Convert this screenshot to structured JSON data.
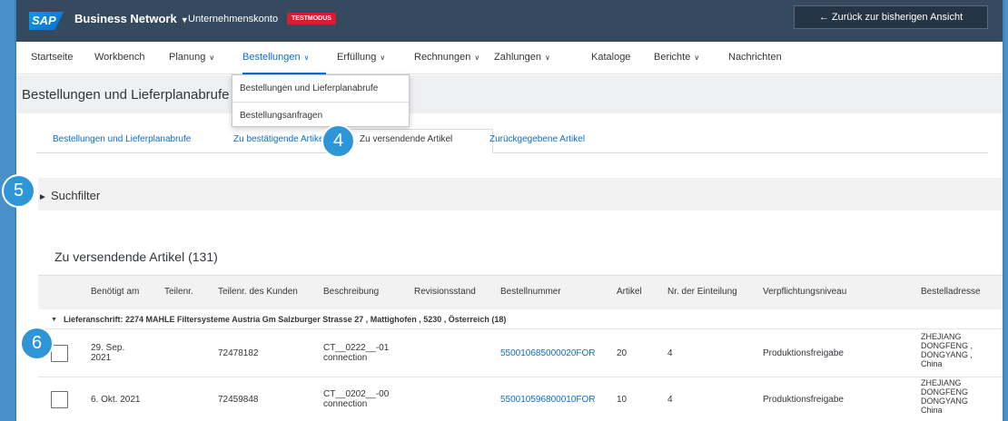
{
  "topbar": {
    "logo": "SAP",
    "product": "Business Network",
    "account": "Unternehmenskonto",
    "test_badge": "TESTMODUS",
    "back_button": "← Zurück zur bisherigen Ansicht"
  },
  "nav": {
    "items": [
      {
        "label": "Startseite"
      },
      {
        "label": "Workbench"
      },
      {
        "label": "Planung"
      },
      {
        "label": "Bestellungen"
      },
      {
        "label": "Erfüllung"
      },
      {
        "label": "Rechnungen"
      },
      {
        "label": "Zahlungen"
      },
      {
        "label": "Kataloge"
      },
      {
        "label": "Berichte"
      },
      {
        "label": "Nachrichten"
      }
    ],
    "chevron": "∨"
  },
  "dropdown": {
    "items": [
      {
        "label": "Bestellungen und Lieferplanabrufe"
      },
      {
        "label": "Bestellungsanfragen"
      }
    ]
  },
  "page": {
    "title": "Bestellungen und Lieferplanabrufe"
  },
  "tabs": [
    {
      "label": "Bestellungen und Lieferplanabrufe"
    },
    {
      "label": "Zu bestätigende Artikel"
    },
    {
      "label": "Zu versendende Artikel"
    },
    {
      "label": "Zurückgegebene Artikel"
    }
  ],
  "filter": {
    "arrow": "►",
    "label": "Suchfilter"
  },
  "table": {
    "title": "Zu versendende Artikel (131)",
    "headers": [
      "Benötigt am",
      "Teilenr.",
      "Teilenr. des Kunden",
      "Beschreibung",
      "Revisionsstand",
      "Bestellnummer",
      "Artikel",
      "Nr. der Einteilung",
      "Verpflichtungsniveau",
      "Bestelladresse"
    ],
    "group": {
      "arrow": "▼",
      "text": "Lieferanschrift: 2274 MAHLE Filtersysteme Austria Gm   Salzburger Strasse 27 , Mattighofen , 5230 , Österreich  (18)"
    },
    "rows": [
      {
        "date_line1": "29. Sep.",
        "date_line2": "2021",
        "customer_part": "72478182",
        "desc_line1": "CT__0222__-01",
        "desc_line2": "connection",
        "order_no": "550010685000020FOR",
        "item": "20",
        "schedule": "4",
        "commitment": "Produktionsfreigabe",
        "addr1": "ZHEJIANG",
        "addr2": "DONGFENG ,",
        "addr3": "DONGYANG ,",
        "addr4": "China"
      },
      {
        "date_line1": "6. Okt. 2021",
        "customer_part": "72459848",
        "desc_line1": "CT__0202__-00",
        "desc_line2": "connection",
        "order_no": "550010596800010FOR",
        "item": "10",
        "schedule": "4",
        "commitment": "Produktionsfreigabe",
        "addr1": "ZHEJIANG",
        "addr2": "DONGFENG",
        "addr3": "DONGYANG",
        "addr4": "China"
      }
    ]
  },
  "badges": [
    "4",
    "5",
    "6"
  ],
  "colors": {
    "shell": "#354a5f",
    "accent": "#0a6ed1",
    "test_badge": "#d32030",
    "step_badge": "#2e96d6"
  }
}
